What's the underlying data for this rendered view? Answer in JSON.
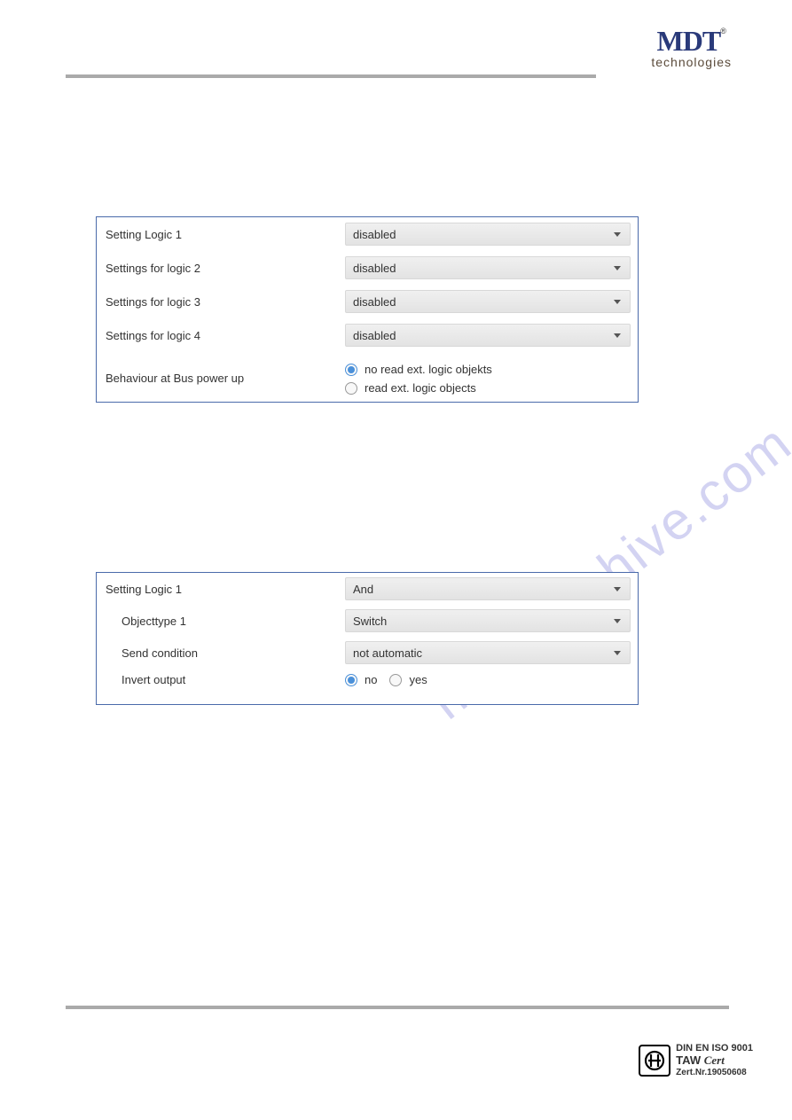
{
  "brand": {
    "name": "MDT",
    "tagline": "technologies",
    "registered": "®"
  },
  "watermark": "manualshive.com",
  "panel1": {
    "rows": [
      {
        "label": "Setting Logic 1",
        "value": "disabled"
      },
      {
        "label": "Settings for logic 2",
        "value": "disabled"
      },
      {
        "label": "Settings for logic 3",
        "value": "disabled"
      },
      {
        "label": "Settings for logic 4",
        "value": "disabled"
      }
    ],
    "bus": {
      "label": "Behaviour at Bus power up",
      "options": [
        {
          "text": "no read ext. logic objekts",
          "checked": true
        },
        {
          "text": "read ext. logic objects",
          "checked": false
        }
      ]
    }
  },
  "panel2": {
    "main": {
      "label": "Setting Logic 1",
      "value": "And"
    },
    "sub": [
      {
        "label": "Objecttype 1",
        "value": "Switch"
      },
      {
        "label": "Send condition",
        "value": "not automatic"
      }
    ],
    "invert": {
      "label": "Invert output",
      "options": [
        {
          "text": "no",
          "checked": true
        },
        {
          "text": "yes",
          "checked": false
        }
      ]
    }
  },
  "cert": {
    "line1": "DIN EN ISO 9001",
    "line2_a": "TAW",
    "line2_b": "Cert",
    "line3": "Zert.Nr.19050608",
    "mark": "ta"
  }
}
